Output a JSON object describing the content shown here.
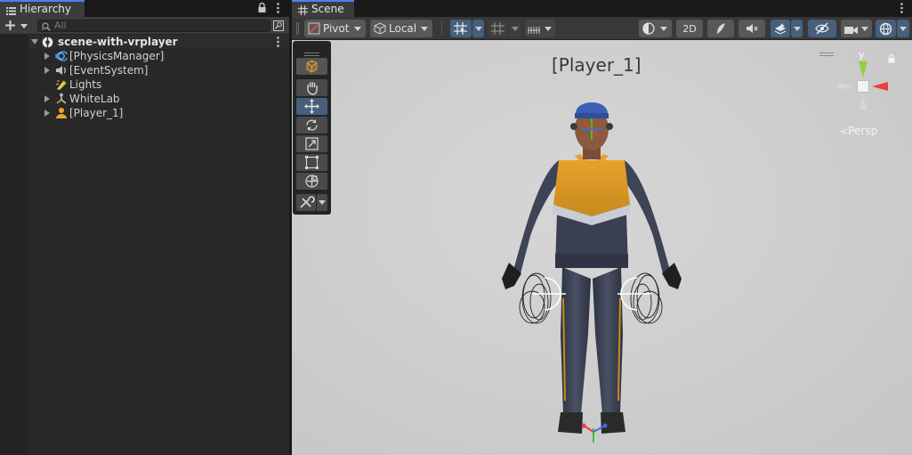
{
  "hierarchy": {
    "tab_title": "Hierarchy",
    "search_placeholder": "All",
    "scene_name": "scene-with-vrplayer",
    "items": [
      {
        "label": "[PhysicsManager]",
        "icon": "physics-manager-icon",
        "expandable": true
      },
      {
        "label": "[EventSystem]",
        "icon": "event-system-icon",
        "expandable": true
      },
      {
        "label": "Lights",
        "icon": "light-icon",
        "expandable": false
      },
      {
        "label": "WhiteLab",
        "icon": "whitelab-icon",
        "expandable": true
      },
      {
        "label": "[Player_1]",
        "icon": "player-icon",
        "expandable": true
      }
    ]
  },
  "scene": {
    "tab_title": "Scene",
    "toolbar": {
      "pivot_label": "Pivot",
      "local_label": "Local",
      "mode_2d_label": "2D"
    },
    "selected_object_label": "[Player_1]",
    "view_mode_label": "Persp",
    "gizmo_axis_label": "y",
    "tools": [
      "view-cube-tool",
      "hand-tool",
      "move-tool",
      "rotate-tool",
      "scale-tool",
      "rect-tool",
      "transform-tool",
      "custom-tool"
    ],
    "selected_tool": "move-tool"
  },
  "colors": {
    "accent": "#4c7efc",
    "selected_button": "#46607c",
    "panel_bg": "#282828",
    "viewport_bg": "#cfcfcf"
  }
}
